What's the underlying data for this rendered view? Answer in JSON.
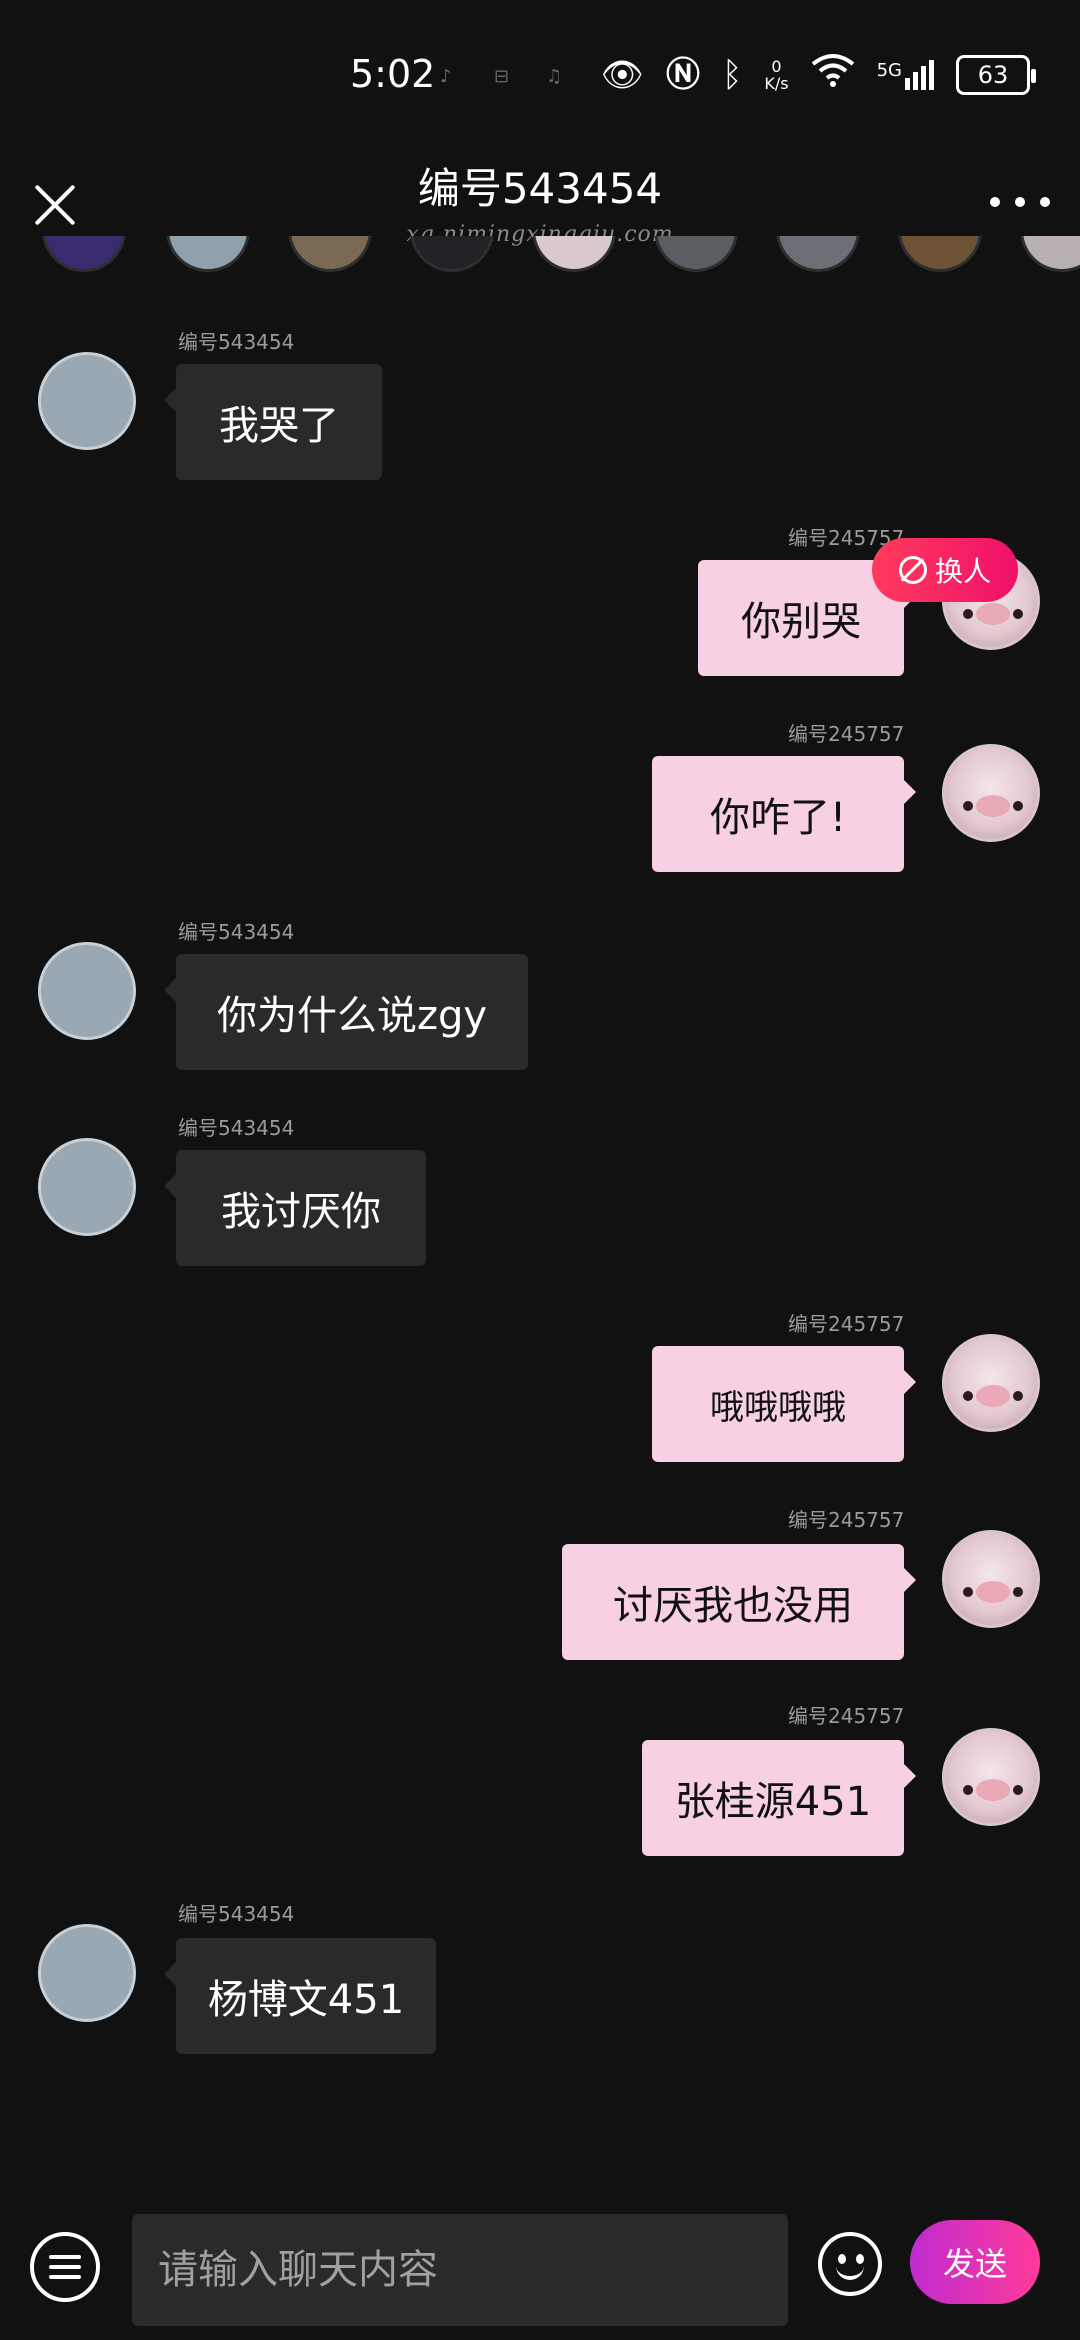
{
  "status_bar": {
    "time": "5:02",
    "mini_icons": [
      "♪",
      "⊟",
      "♫"
    ],
    "net_speed_value": "0",
    "net_speed_unit": "K/s",
    "network": "5G",
    "battery": "63"
  },
  "header": {
    "title": "编号543454",
    "subtitle": "xq.nimingxingqiu.com"
  },
  "avatar_strip": {
    "colors": [
      "#3a2a6e",
      "#8fa1ad",
      "#7a6a55",
      "#222226",
      "#d9c9cc",
      "#5a5e63",
      "#6a7075",
      "#6e5236",
      "#b9b0b3"
    ]
  },
  "messages": [
    {
      "side": "left",
      "sender": "编号543454",
      "text": "我哭了"
    },
    {
      "side": "right",
      "sender": "编号245757",
      "text": "你别哭"
    },
    {
      "side": "right",
      "sender": "编号245757",
      "text": "你咋了!"
    },
    {
      "side": "left",
      "sender": "编号543454",
      "text": "你为什么说zgy"
    },
    {
      "side": "left",
      "sender": "编号543454",
      "text": "我讨厌你"
    },
    {
      "side": "right",
      "sender": "编号245757",
      "text": "哦哦哦哦"
    },
    {
      "side": "right",
      "sender": "编号245757",
      "text": "讨厌我也没用"
    },
    {
      "side": "right",
      "sender": "编号245757",
      "text": "张桂源451"
    },
    {
      "side": "left",
      "sender": "编号543454",
      "text": "杨博文451"
    }
  ],
  "swap_badge": {
    "label": "换人"
  },
  "input_bar": {
    "placeholder": "请输入聊天内容",
    "send_label": "发送"
  },
  "colors": {
    "background": "#111112",
    "left_bubble": "#2a2a2b",
    "right_bubble": "#f7d0e3",
    "accent": "#f0106a"
  }
}
